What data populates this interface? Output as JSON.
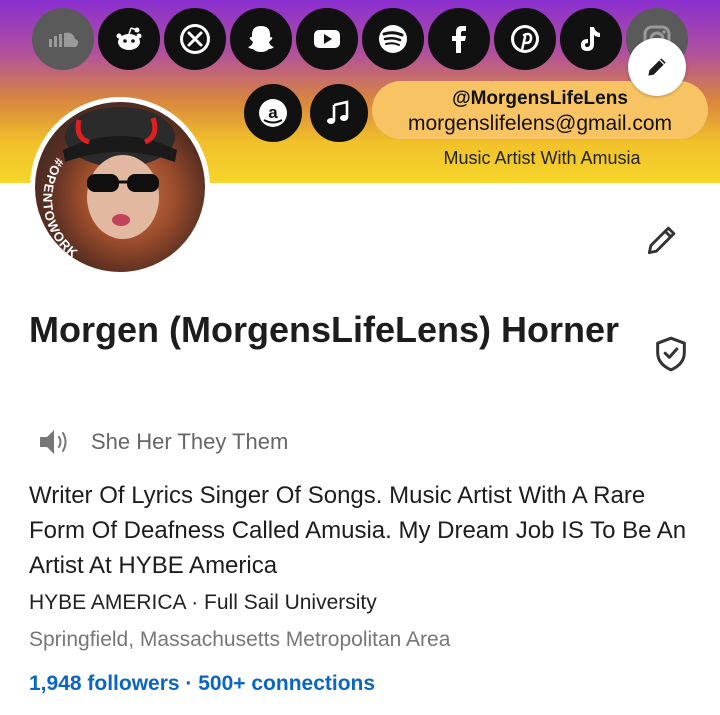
{
  "banner": {
    "social_icons": [
      {
        "name": "soundcloud-icon",
        "glyph": "☁"
      },
      {
        "name": "reddit-icon",
        "glyph": "👽"
      },
      {
        "name": "x-icon",
        "glyph": "✕"
      },
      {
        "name": "snapchat-icon",
        "glyph": "👻"
      },
      {
        "name": "youtube-icon",
        "glyph": "▶"
      },
      {
        "name": "spotify-icon",
        "glyph": "≋"
      },
      {
        "name": "facebook-icon",
        "glyph": "f"
      },
      {
        "name": "pinterest-icon",
        "glyph": "P"
      },
      {
        "name": "tiktok-icon",
        "glyph": "♪"
      },
      {
        "name": "instagram-icon",
        "glyph": "◎"
      }
    ],
    "row2_icons": [
      {
        "name": "amazon-icon",
        "glyph": "a"
      },
      {
        "name": "music-note-icon",
        "glyph": "♫"
      }
    ],
    "handle": "@MorgensLifeLens",
    "email": "morgenslifelens@gmail.com",
    "tagline": "Music Artist With Amusia",
    "accent_colors": {
      "top": "#8a2fd0",
      "bottom": "#f6d52a",
      "pill": "#f8c463"
    }
  },
  "avatar": {
    "badge_text": "#OPENTOWORK",
    "badge_color": "#2e7d32"
  },
  "profile": {
    "name": "Morgen (MorgensLifeLens) Horner",
    "pronouns": "She Her They Them",
    "headline": "Writer Of Lyrics Singer Of Songs. Music Artist With A Rare Form Of Deafness Called Amusia. My Dream Job IS To Be An Artist At HYBE America",
    "education_line": "HYBE AMERICA · Full Sail University",
    "location": "Springfield, Massachusetts Metropolitan Area",
    "network": "1,948 followers · 500+ connections",
    "link_color": "#0a66c2"
  }
}
